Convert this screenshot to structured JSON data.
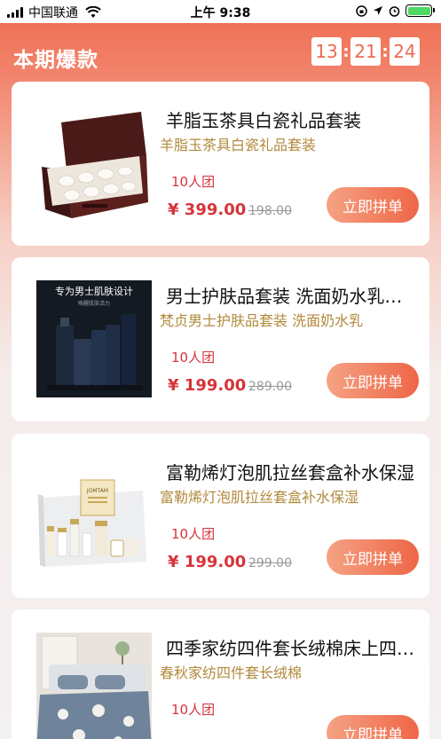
{
  "status_bar": {
    "carrier": "中国联通",
    "time": "上午 9:38"
  },
  "header": {
    "title": "本期爆款",
    "countdown": {
      "hours": "13",
      "minutes": "21",
      "seconds": "24",
      "separator": ":"
    }
  },
  "products": [
    {
      "title": "羊脂玉茶具白瓷礼品套装",
      "subtitle": "羊脂玉茶具白瓷礼品套装",
      "group": "10人团",
      "price": "¥ 399.00",
      "original_price": "198.00",
      "button": "立即拼单"
    },
    {
      "title": "男士护肤品套装 洗面奶水乳套装",
      "subtitle": "梵贞男士护肤品套装 洗面奶水乳",
      "group": "10人团",
      "price": "¥ 199.00",
      "original_price": "289.00",
      "button": "立即拼单",
      "image_text": {
        "headline": "专为男士肌肤设计",
        "sub": "唤醒肌肤活力"
      }
    },
    {
      "title": "富勒烯灯泡肌拉丝套盒补水保湿",
      "subtitle": "富勒烯灯泡肌拉丝套盒补水保湿",
      "group": "10人团",
      "price": "¥ 199.00",
      "original_price": "299.00",
      "button": "立即拼单",
      "image_text": {
        "brand": "JOMTAM"
      }
    },
    {
      "title": "四季家纺四件套长绒棉床上四件套",
      "subtitle": "春秋家纺四件套长绒棉",
      "group": "10人团",
      "price": "",
      "original_price": "",
      "button": "立即拼单"
    }
  ],
  "colors": {
    "accent": "#ed6a4e",
    "price": "#d6343a",
    "subtitle": "#b18a3c"
  }
}
